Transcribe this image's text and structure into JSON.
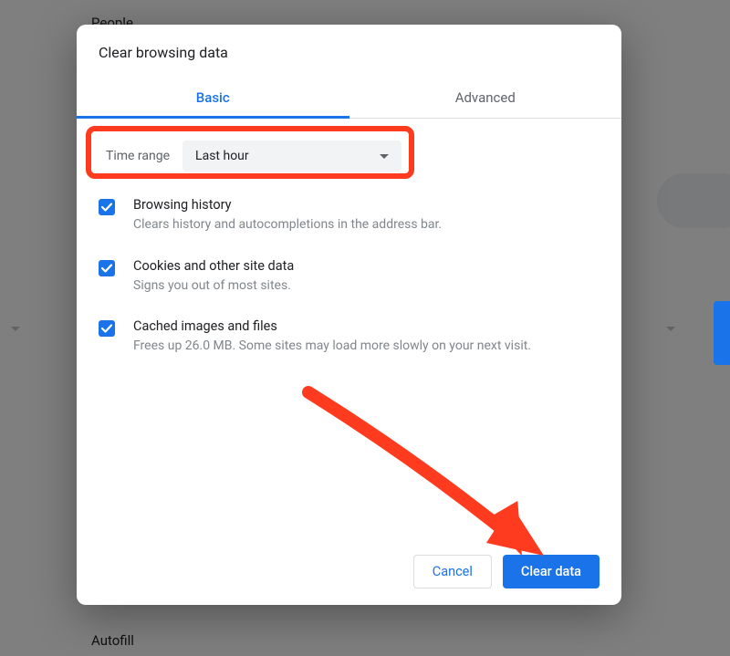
{
  "background": {
    "text_top": "People",
    "text_bottom": "Autofill"
  },
  "dialog": {
    "title": "Clear browsing data",
    "tabs": {
      "basic": "Basic",
      "advanced": "Advanced"
    },
    "time_range": {
      "label": "Time range",
      "value": "Last hour"
    },
    "options": [
      {
        "title": "Browsing history",
        "desc": "Clears history and autocompletions in the address bar."
      },
      {
        "title": "Cookies and other site data",
        "desc": "Signs you out of most sites."
      },
      {
        "title": "Cached images and files",
        "desc": "Frees up 26.0 MB. Some sites may load more slowly on your next visit."
      }
    ],
    "buttons": {
      "cancel": "Cancel",
      "clear": "Clear data"
    }
  },
  "annotation": {
    "arrow_color": "#ff3b1f"
  }
}
